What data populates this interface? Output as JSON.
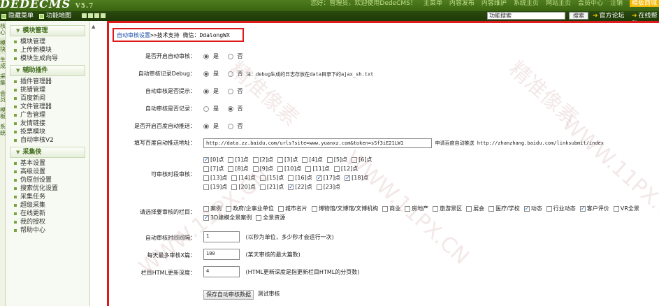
{
  "header": {
    "logo": "DEDECMS",
    "version": "V5.7",
    "nav": [
      "您好：管理员，欢迎使用DedeCMS！",
      "主菜单",
      "内容发布",
      "内容维护",
      "系统主页",
      "网站主页",
      "会员中心",
      "注销",
      "模板商城"
    ]
  },
  "subbar": {
    "hide_menu": "隐藏菜单",
    "function_map": "功能地图",
    "search_value": "功能搜索",
    "search_button": "搜索",
    "links": [
      "官方论坛",
      "在线帮助"
    ]
  },
  "rail": [
    "核心",
    "模块",
    "生成",
    "采集",
    "会员",
    "模板",
    "系统"
  ],
  "sidebar": {
    "sections": [
      {
        "title": "模块管理",
        "items": [
          "模块管理",
          "上传新模块",
          "模块生成向导"
        ]
      },
      {
        "title": "辅助插件",
        "items": [
          "插件管理器",
          "挑错管理",
          "百度新闻",
          "文件管理器",
          "广告管理",
          "友情链接",
          "投票模块",
          "自动审核V2"
        ]
      },
      {
        "title": "采集侠",
        "items": [
          "基本设置",
          "高级设置",
          "伪原创设置",
          "搜索优化设置",
          "采集任务",
          "超级采集",
          "在线更新",
          "我的授权",
          "帮助中心"
        ]
      }
    ]
  },
  "breadcrumb": {
    "link": "自动审核设置",
    "rest": ">>技术支持 微信：DdalongWX"
  },
  "form": {
    "enable": {
      "label": "是否开启自动审核：",
      "options": [
        "是",
        "否"
      ],
      "selected": 0
    },
    "debug": {
      "label": "自动审核记录Debug：",
      "options": [
        "是",
        "否"
      ],
      "selected": 0,
      "note": "注：debug生成的日志存放在data目录下的ajax_sh.txt"
    },
    "prompt": {
      "label": "自动审核是否提示：",
      "options": [
        "是",
        "否"
      ],
      "selected": 0
    },
    "record": {
      "label": "自动审核是否记录：",
      "options": [
        "是",
        "否"
      ],
      "selected": 1
    },
    "baidu_push": {
      "label": "是否开启百度自动推送：",
      "options": [
        "是",
        "否"
      ],
      "selected": 0
    },
    "baidu_url": {
      "label": "填写百度自动推送地址：",
      "value": "http://data.zz.baidu.com/urls?site=www.yuanxz.com&token=sSf3iE21LW1",
      "hint": "申请百度自动推送 http://zhanzhang.baidu.com/linksubmit/index"
    },
    "hours": {
      "label": "可审核时段审核：",
      "rows": [
        [
          {
            "t": "[0]点",
            "c": true
          },
          {
            "t": "[1]点",
            "c": false
          },
          {
            "t": "[2]点",
            "c": false
          },
          {
            "t": "[3]点",
            "c": false
          },
          {
            "t": "[4]点",
            "c": false
          },
          {
            "t": "[5]点",
            "c": false
          },
          {
            "t": "[6]点",
            "c": false
          }
        ],
        [
          {
            "t": "[7]点",
            "c": false
          },
          {
            "t": "[8]点",
            "c": false
          },
          {
            "t": "[9]点",
            "c": false
          },
          {
            "t": "[10]点",
            "c": false
          },
          {
            "t": "[11]点",
            "c": false
          },
          {
            "t": "[12]点",
            "c": false
          }
        ],
        [
          {
            "t": "[13]点",
            "c": false
          },
          {
            "t": "[14]点",
            "c": false
          },
          {
            "t": "[15]点",
            "c": false
          },
          {
            "t": "[16]点",
            "c": false
          },
          {
            "t": "[17]点",
            "c": true
          },
          {
            "t": "[18]点",
            "c": true
          }
        ],
        [
          {
            "t": "[19]点",
            "c": false
          },
          {
            "t": "[20]点",
            "c": false
          },
          {
            "t": "[21]点",
            "c": false
          },
          {
            "t": "[22]点",
            "c": true
          },
          {
            "t": "[23]点",
            "c": false
          }
        ]
      ]
    },
    "columns": {
      "label": "请选择要审核的栏目：",
      "rows": [
        [
          {
            "t": "案例",
            "c": false
          },
          {
            "t": "政府/企事业单位",
            "c": false
          },
          {
            "t": "城市名片",
            "c": false
          },
          {
            "t": "博物馆/文博馆/文博机构",
            "c": false
          },
          {
            "t": "商业",
            "c": false
          },
          {
            "t": "房地产",
            "c": false
          },
          {
            "t": "旅游景区",
            "c": false
          },
          {
            "t": "展会",
            "c": false
          },
          {
            "t": "医疗/学校",
            "c": false
          },
          {
            "t": "动态",
            "c": true
          },
          {
            "t": "行业动态",
            "c": false
          },
          {
            "t": "客户评价",
            "c": true
          },
          {
            "t": "VR全景",
            "c": false
          }
        ],
        [
          {
            "t": "3D建模全景案例",
            "c": true
          },
          {
            "t": "全景资源",
            "c": false
          }
        ]
      ]
    },
    "interval": {
      "label": "自动审核时间间隔：",
      "value": "1",
      "hint": "(以秒为单位，多少秒才会运行一次)"
    },
    "max_per_day": {
      "label": "每天最多审核X篇：",
      "value": "100",
      "hint": "(某天审核的最大篇数)"
    },
    "html_depth": {
      "label": "栏目HTML更新深度：",
      "value": "4",
      "hint": "(HTML更新深度是指更新栏目HTML的分页数)"
    },
    "save_button": "保存自动审核数据",
    "test_button": "测试审核"
  },
  "watermark": [
    "精准像素",
    "WWW.11PX.CN"
  ]
}
